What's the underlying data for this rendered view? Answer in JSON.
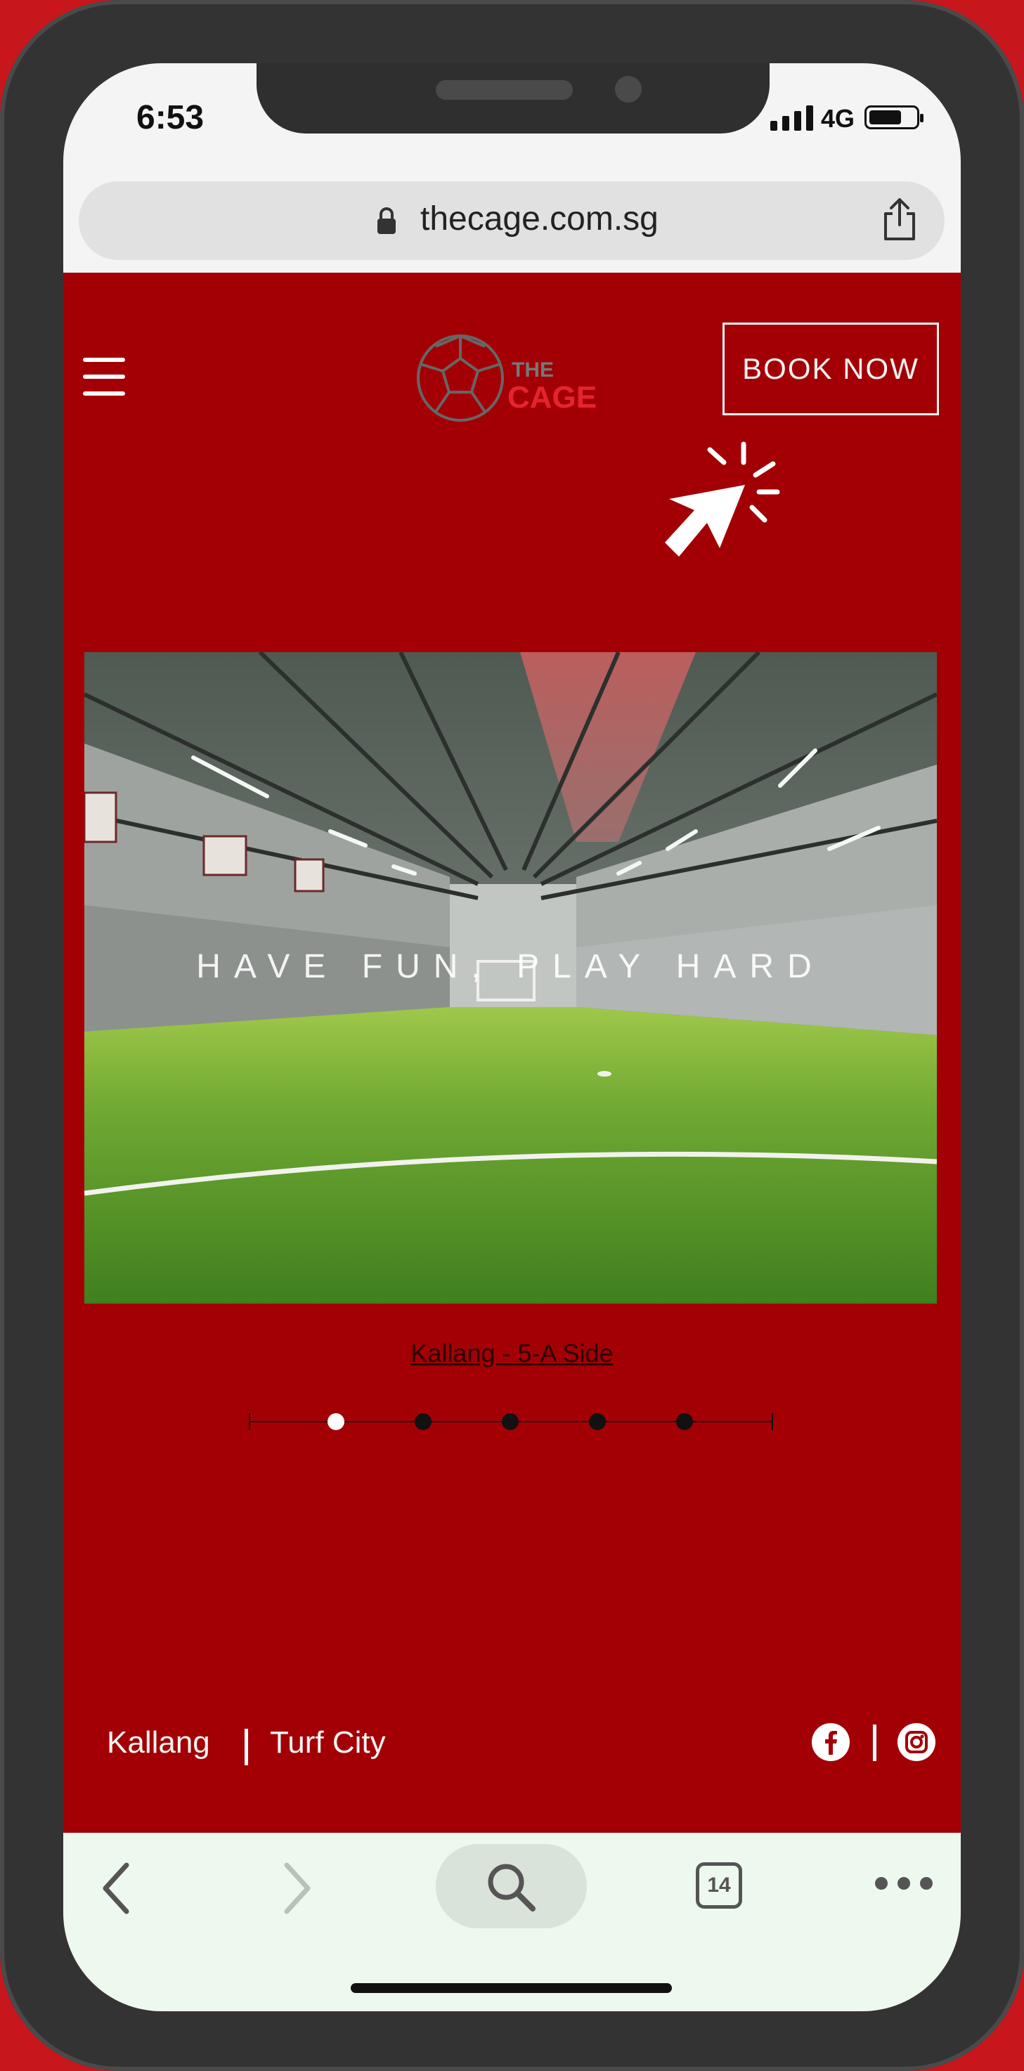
{
  "status_bar": {
    "time": "6:53",
    "network": "4G",
    "battery_level": 0.7
  },
  "browser": {
    "url": "thecage.com.sg",
    "tab_count": "14"
  },
  "header": {
    "logo_top": "THE",
    "logo_bottom": "CAGE",
    "book_label": "BOOK NOW"
  },
  "hero": {
    "title": "HAVE FUN, PLAY HARD",
    "slide_label": "Kallang - 5-A Side",
    "slide_count": 5,
    "active_slide": 1
  },
  "footer": {
    "locations": [
      "Kallang",
      "Turf City"
    ]
  },
  "colors": {
    "brand_red": "#a30006",
    "background_red": "#c8161d",
    "logo_red": "#e5242e"
  },
  "icons": [
    "menu-icon",
    "lock-icon",
    "share-icon",
    "pointer-cursor-icon",
    "facebook-icon",
    "instagram-icon",
    "back-icon",
    "forward-icon",
    "search-icon",
    "more-icon"
  ]
}
